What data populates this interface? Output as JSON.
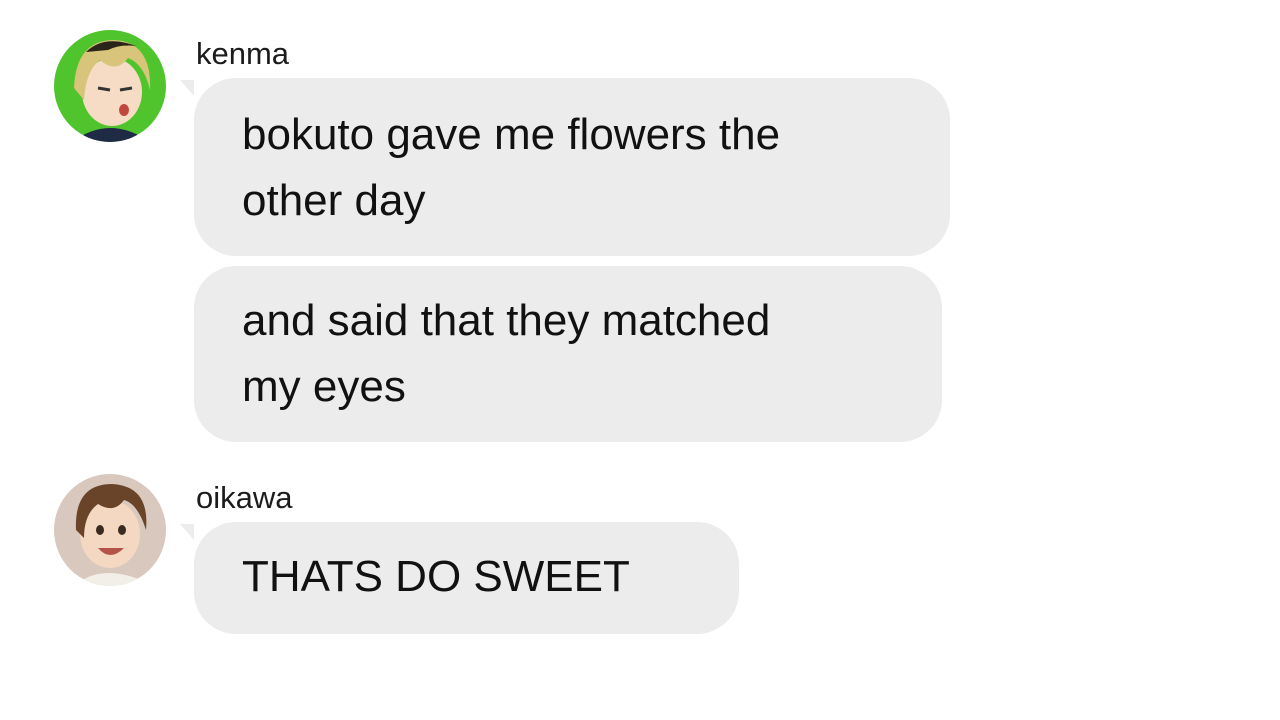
{
  "messages": [
    {
      "sender": "kenma",
      "avatar_icon": "anime-boy-blonde-avatar",
      "bubbles": [
        {
          "line1": "bokuto gave me flowers the",
          "line2": "other day"
        },
        {
          "line1": "and said that they matched",
          "line2": "my eyes"
        }
      ]
    },
    {
      "sender": "oikawa",
      "avatar_icon": "anime-boy-brown-hair-avatar",
      "bubbles": [
        {
          "line1": "THATS DO SWEET"
        }
      ]
    }
  ],
  "colors": {
    "bubble": "#ececed",
    "background": "#ffffff",
    "text": "#111111"
  }
}
